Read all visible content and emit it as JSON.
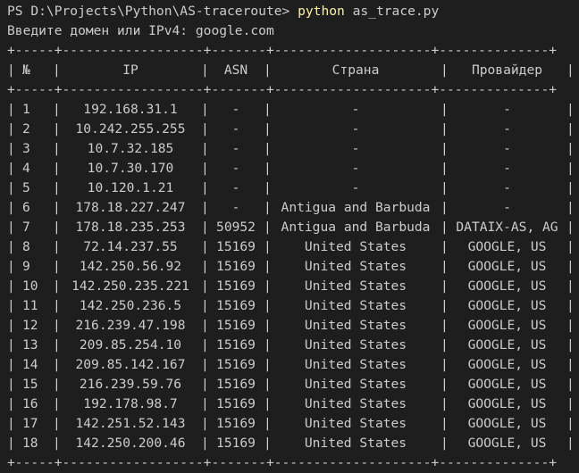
{
  "prompt": "PS D:\\Projects\\Python\\AS-traceroute> ",
  "command": {
    "program": "python",
    "args": " as_trace.py"
  },
  "input_prompt": "Введите домен или IPv4: ",
  "input_value": "google.com",
  "table": {
    "border_line": "+-----+------------------+-------+--------------------+--------------+",
    "headers": [
      "№",
      "IP",
      "ASN",
      "Страна",
      "Провайдер"
    ],
    "rows": [
      [
        "1",
        "192.168.31.1",
        "-",
        "-",
        "-"
      ],
      [
        "2",
        "10.242.255.255",
        "-",
        "-",
        "-"
      ],
      [
        "3",
        "10.7.32.185",
        "-",
        "-",
        "-"
      ],
      [
        "4",
        "10.7.30.170",
        "-",
        "-",
        "-"
      ],
      [
        "5",
        "10.120.1.21",
        "-",
        "-",
        "-"
      ],
      [
        "6",
        "178.18.227.247",
        "-",
        "Antigua and Barbuda",
        "-"
      ],
      [
        "7",
        "178.18.235.253",
        "50952",
        "Antigua and Barbuda",
        "DATAIX-AS, AG"
      ],
      [
        "8",
        "72.14.237.55",
        "15169",
        "United States",
        "GOOGLE, US"
      ],
      [
        "9",
        "142.250.56.92",
        "15169",
        "United States",
        "GOOGLE, US"
      ],
      [
        "10",
        "142.250.235.221",
        "15169",
        "United States",
        "GOOGLE, US"
      ],
      [
        "11",
        "142.250.236.5",
        "15169",
        "United States",
        "GOOGLE, US"
      ],
      [
        "12",
        "216.239.47.198",
        "15169",
        "United States",
        "GOOGLE, US"
      ],
      [
        "13",
        "209.85.254.10",
        "15169",
        "United States",
        "GOOGLE, US"
      ],
      [
        "14",
        "209.85.142.167",
        "15169",
        "United States",
        "GOOGLE, US"
      ],
      [
        "15",
        "216.239.59.76",
        "15169",
        "United States",
        "GOOGLE, US"
      ],
      [
        "16",
        "192.178.98.7",
        "15169",
        "United States",
        "GOOGLE, US"
      ],
      [
        "17",
        "142.251.52.143",
        "15169",
        "United States",
        "GOOGLE, US"
      ],
      [
        "18",
        "142.250.200.46",
        "15169",
        "United States",
        "GOOGLE, US"
      ]
    ]
  },
  "colors": {
    "background": "#1e1e1e",
    "text": "#cccccc",
    "command_highlight": "#f9f1a5"
  }
}
